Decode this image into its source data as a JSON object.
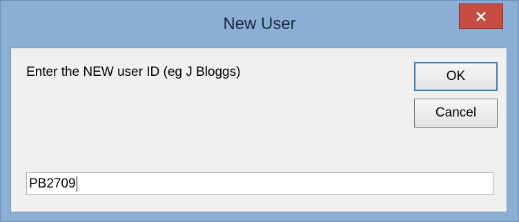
{
  "dialog": {
    "title": "New User",
    "close_icon": "close-x-icon",
    "prompt": "Enter the NEW user ID (eg J Bloggs)",
    "ok_label": "OK",
    "cancel_label": "Cancel",
    "user_id_value": "PB2709"
  },
  "colors": {
    "titlebar": "#8aaed6",
    "close_button": "#c64d42",
    "client_bg": "#f0f0f0"
  }
}
